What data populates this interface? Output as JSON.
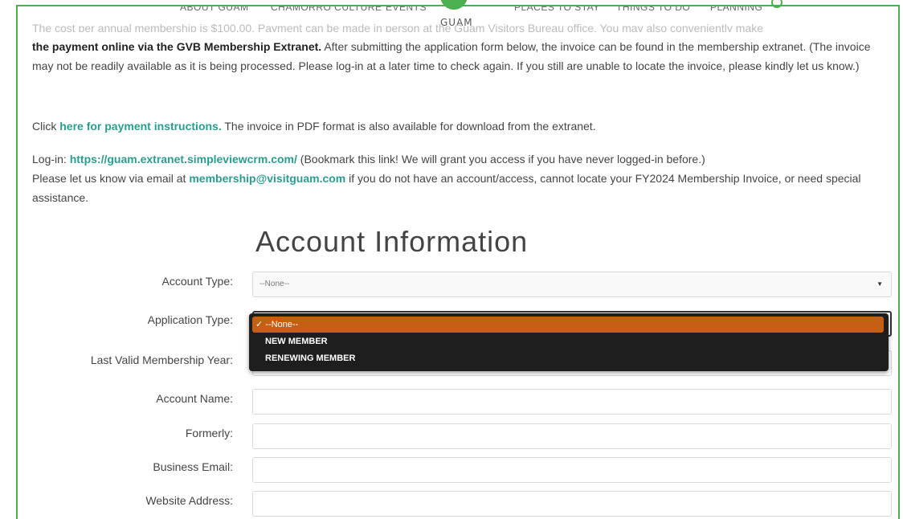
{
  "nav": {
    "items": [
      "ABOUT GUAM",
      "CHAMORRO CULTURE",
      "EVENTS",
      "PLACES TO STAY",
      "THINGS TO DO",
      "PLANNING"
    ],
    "logo_text": "GUAM"
  },
  "intro": {
    "cut_line": "The cost per annual membership is $100.00. Payment can be made in person at the Guam Visitors Bureau office. You may also conveniently make",
    "p1_bold": "the payment online via the GVB Membership Extranet.",
    "p1_rest": "After submitting the application form below, the invoice can be found in the membership extranet. (The invoice may not be readily available as it is being processed. Please log-in at a later time to check again. If you still are unable to locate the invoice, please kindly let us know.)",
    "p2_pre": "Click",
    "p2_link": "here for payment instructions.",
    "p2_post": "The invoice in PDF format is also available for download from the extranet.",
    "p3_login_label": "Log-in:",
    "p3_login_link": "https://guam.extranet.simpleviewcrm.com/",
    "p3_login_note": "(Bookmark this link! We will grant you access if you have never logged-in before.)",
    "p3_email_pre": "Please let us know via email at",
    "p3_email_link": "membership@visitguam.com",
    "p3_email_post": "if you do not have an account/access, cannot locate your FY2024 Membership Invoice, or need special assistance."
  },
  "form": {
    "title": "Account Information",
    "account_type_label": "Account Type:",
    "account_type_value": "--None--",
    "application_type_label": "Application Type:",
    "last_valid_label": "Last Valid Membership Year:",
    "account_name_label": "Account Name:",
    "formerly_label": "Formerly:",
    "business_email_label": "Business Email:",
    "website_label": "Website Address:"
  },
  "dropdown": {
    "options": [
      "--None--",
      "NEW MEMBER",
      "RENEWING MEMBER"
    ],
    "checkmark": "✓"
  },
  "colors": {
    "accent_green": "#4caf50",
    "link_teal": "#2a9d8f",
    "dropdown_selected": "#c45f14"
  }
}
